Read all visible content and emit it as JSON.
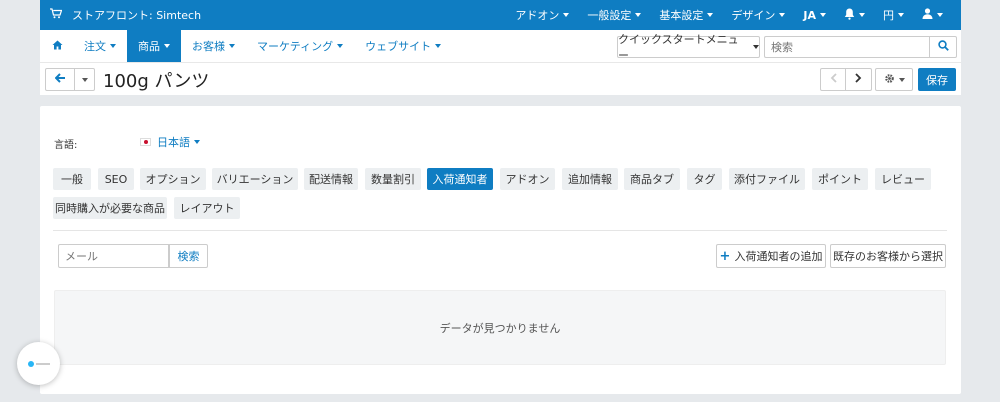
{
  "topbar": {
    "store_label": "ストアフロント: Simtech",
    "menus": [
      {
        "label": "アドオン"
      },
      {
        "label": "一般設定"
      },
      {
        "label": "基本設定"
      },
      {
        "label": "デザイン"
      },
      {
        "label": "JA"
      },
      {
        "label": ""
      },
      {
        "label": "円"
      },
      {
        "label": ""
      }
    ]
  },
  "nav": {
    "items": [
      {
        "label": "注文"
      },
      {
        "label": "商品"
      },
      {
        "label": "お客様"
      },
      {
        "label": "マーケティング"
      },
      {
        "label": "ウェブサイト"
      }
    ],
    "quickstart": "クイックスタートメニュー",
    "search_placeholder": "検索"
  },
  "titlebar": {
    "title": "100g パンツ",
    "save": "保存"
  },
  "panel": {
    "lang_label": "言語:",
    "lang_value": "日本語",
    "tabs": [
      {
        "label": "一般"
      },
      {
        "label": "SEO"
      },
      {
        "label": "オプション"
      },
      {
        "label": "バリエーション"
      },
      {
        "label": "配送情報"
      },
      {
        "label": "数量割引"
      },
      {
        "label": "入荷通知者"
      },
      {
        "label": "アドオン"
      },
      {
        "label": "追加情報"
      },
      {
        "label": "商品タブ"
      },
      {
        "label": "タグ"
      },
      {
        "label": "添付ファイル"
      },
      {
        "label": "ポイント"
      },
      {
        "label": "レビュー"
      },
      {
        "label": "同時購入が必要な商品"
      },
      {
        "label": "レイアウト"
      }
    ],
    "active_tab": "入荷通知者",
    "email_placeholder": "メール",
    "search_button": "検索",
    "add_button": "入荷通知者の追加",
    "select_button": "既存のお客様から選択",
    "empty_message": "データが見つかりません"
  },
  "colors": {
    "accent": "#0f7dc2",
    "background": "#e6e9ec"
  }
}
